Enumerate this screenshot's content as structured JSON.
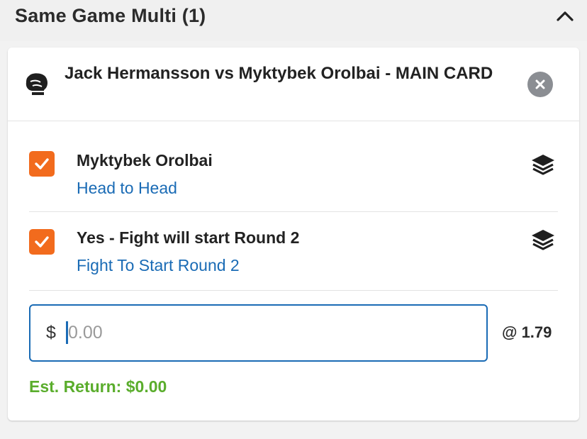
{
  "header": {
    "title": "Same Game Multi (1)",
    "collapse_icon": "chevron-up-icon"
  },
  "event": {
    "icon": "boxing-glove-icon",
    "title": "Jack Hermansson vs Myktybek Orolbai - MAIN CARD",
    "close_icon": "close-icon"
  },
  "legs": [
    {
      "selected": true,
      "selection": "Myktybek Orolbai",
      "market": "Head to Head",
      "icon": "layers-icon"
    },
    {
      "selected": true,
      "selection": "Yes - Fight will start Round 2",
      "market": "Fight To Start Round 2",
      "icon": "layers-icon"
    }
  ],
  "stake": {
    "currency_symbol": "$",
    "placeholder": "0.00",
    "value": ""
  },
  "odds": "@ 1.79",
  "est_return": "Est. Return: $0.00",
  "colors": {
    "accent_blue": "#1a6bb5",
    "checkbox_orange": "#f26b1d",
    "return_green": "#5aad2c",
    "close_grey": "#8b8e93"
  }
}
